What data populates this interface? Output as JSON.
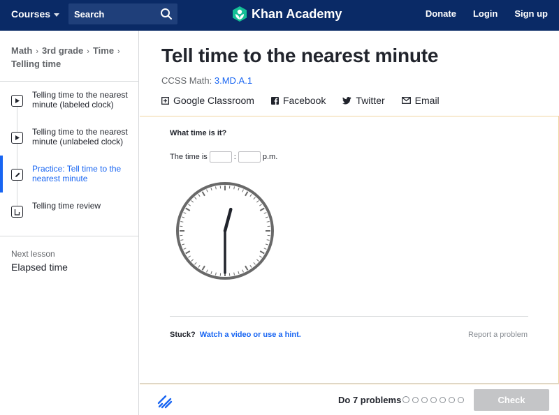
{
  "nav": {
    "courses_label": "Courses",
    "search_placeholder": "Search",
    "brand": "Khan Academy",
    "donate": "Donate",
    "login": "Login",
    "signup": "Sign up"
  },
  "breadcrumb": [
    "Math",
    "3rd grade",
    "Time",
    "Telling time"
  ],
  "lessons": [
    {
      "line1": "Telling time to the nearest",
      "line2": "minute (labeled clock)",
      "icon": "play-icon",
      "active": false
    },
    {
      "line1": "Telling time to the nearest",
      "line2": "minute (unlabeled clock)",
      "icon": "play-icon",
      "active": false
    },
    {
      "line1": "Practice: Tell time to the",
      "line2": "nearest minute",
      "icon": "pencil-icon",
      "active": true
    },
    {
      "line1": "Telling time review",
      "line2": "",
      "icon": "article-icon",
      "active": false
    }
  ],
  "next_lesson": {
    "label": "Next lesson",
    "title": "Elapsed time"
  },
  "main": {
    "title": "Tell time to the nearest minute",
    "ccss_prefix": "CCSS Math:",
    "ccss_code": "3.MD.A.1",
    "share": {
      "classroom": "Google Classroom",
      "facebook": "Facebook",
      "twitter": "Twitter",
      "email": "Email"
    }
  },
  "exercise": {
    "question": "What time is it?",
    "time_prefix": "The time is",
    "colon": ":",
    "suffix": "p.m.",
    "stuck": "Stuck?",
    "hint_link": "Watch a video or use a hint.",
    "report": "Report a problem",
    "clock": {
      "hours": 12,
      "minutes": 30
    }
  },
  "footer": {
    "do_problems": "Do 7 problems",
    "problem_count": 7,
    "check": "Check"
  },
  "colors": {
    "nav_bg": "#0a2a66",
    "accent": "#1865f2",
    "logo_green": "#14bf96",
    "check_disabled": "#c4c5c7"
  }
}
